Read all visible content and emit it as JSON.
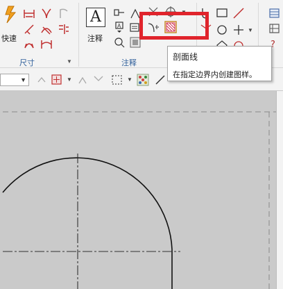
{
  "ribbon": {
    "quick_label": "快速",
    "dimension_group": "尺寸",
    "annotation_label": "注释",
    "annotation_group": "注释",
    "more_arrow": "▼"
  },
  "tooltip": {
    "title": "剖面线",
    "description": "在指定边界内创建图样。"
  },
  "toolbar": {
    "combo_value": ""
  },
  "colors": {
    "highlight": "#e0242c",
    "group_label": "#2f5f9a",
    "canvas": "#cacaca"
  }
}
